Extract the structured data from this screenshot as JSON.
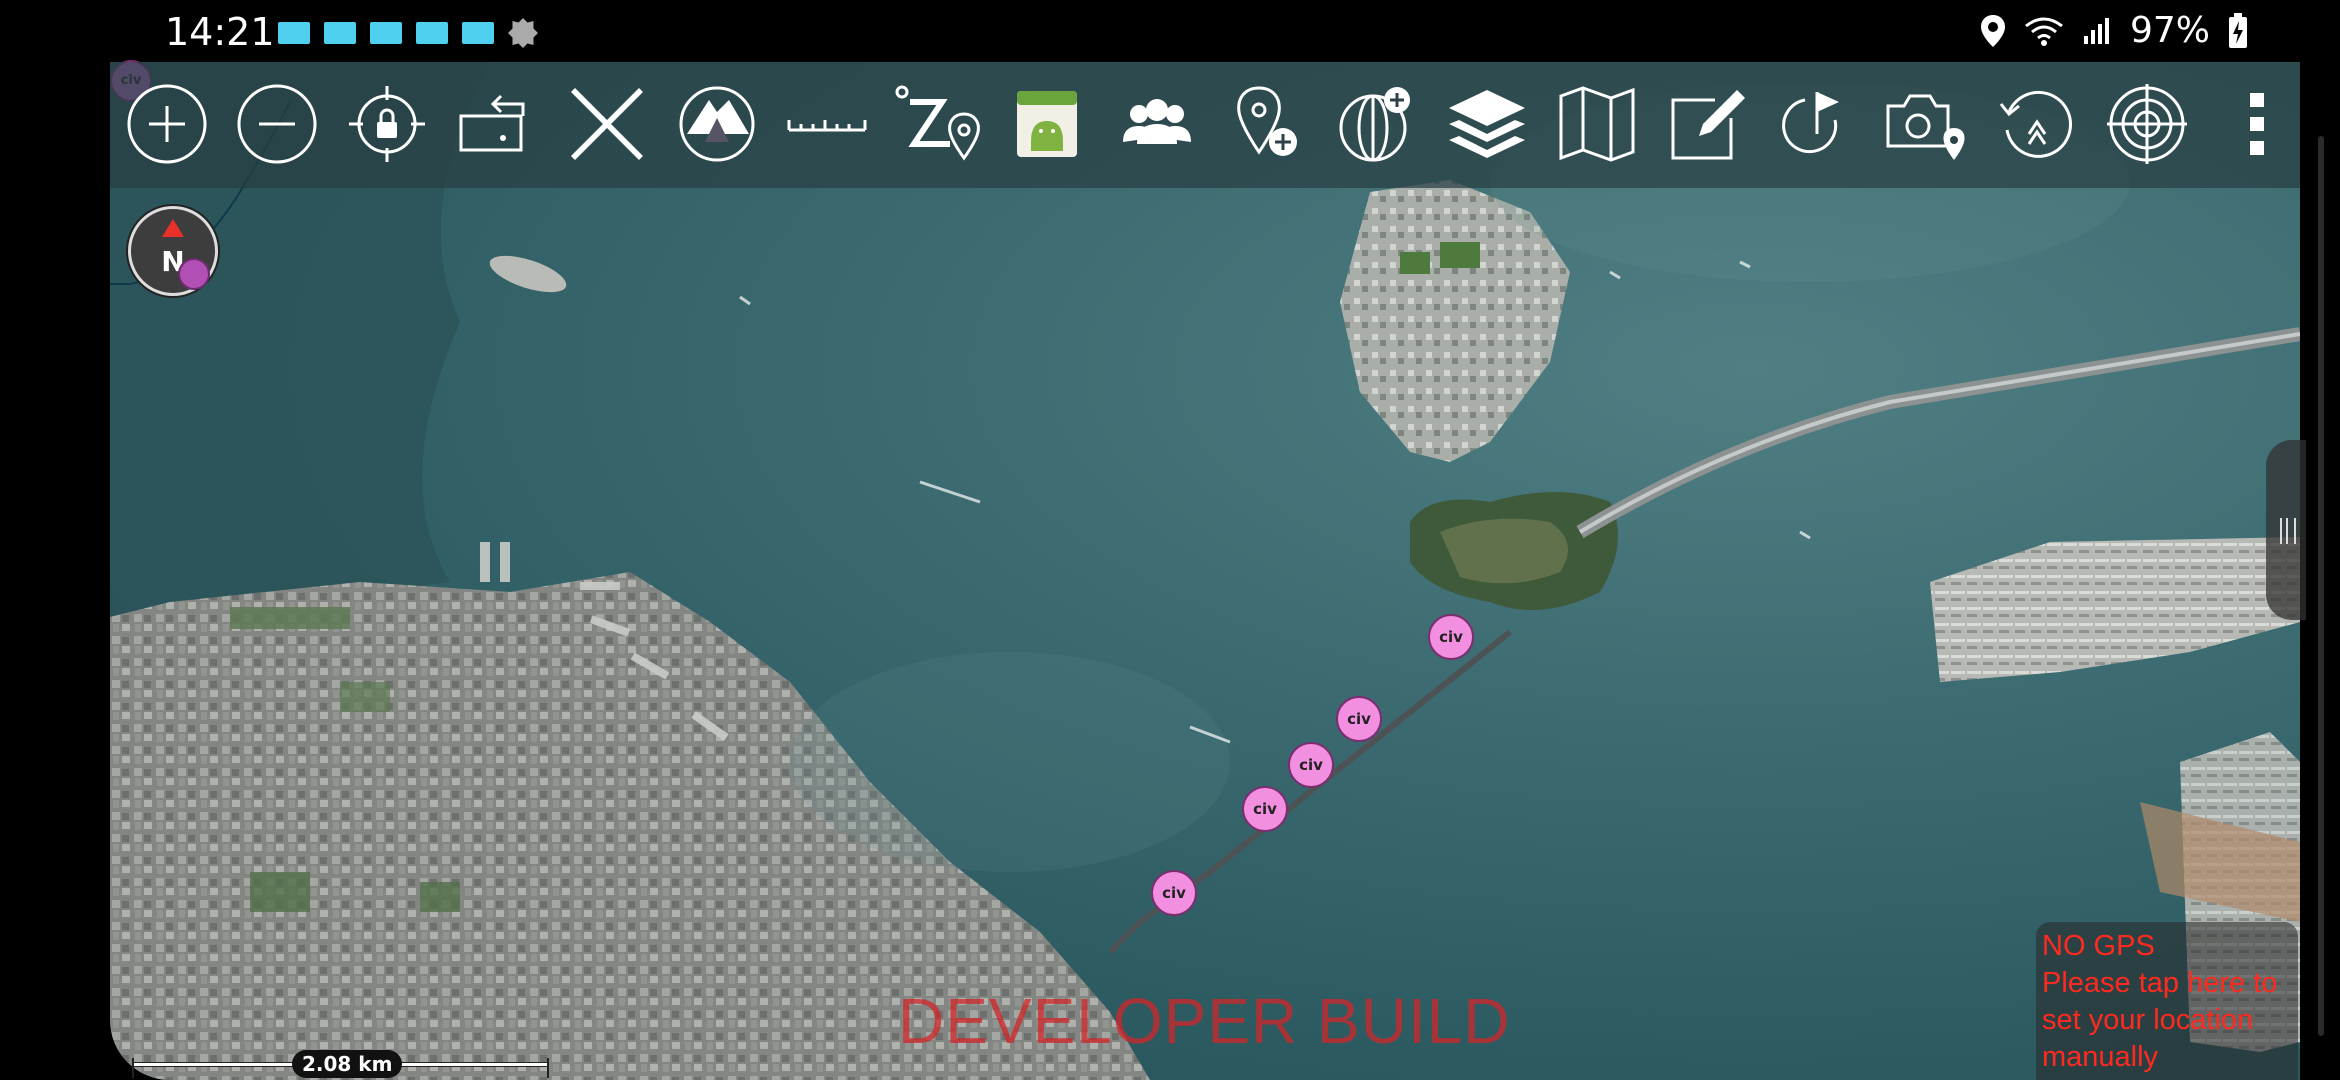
{
  "status_bar": {
    "time": "14:21",
    "notification_icons": [
      "notification-icon",
      "notification-icon",
      "notification-icon",
      "notification-icon",
      "notification-icon",
      "settings-cog-icon"
    ],
    "battery_text": "97%",
    "icons": [
      "location-icon",
      "wifi-icon",
      "signal-icon",
      "battery-charging-icon"
    ]
  },
  "toolbar": {
    "buttons": [
      {
        "name": "zoom-in-icon"
      },
      {
        "name": "zoom-out-icon"
      },
      {
        "name": "lock-location-icon"
      },
      {
        "name": "rotate-map-icon"
      },
      {
        "name": "close-x-icon"
      },
      {
        "name": "tilt-3d-icon"
      },
      {
        "name": "ruler-icon"
      },
      {
        "name": "route-waypoint-icon"
      },
      {
        "name": "android-app-icon"
      },
      {
        "name": "contacts-group-icon"
      },
      {
        "name": "add-point-icon"
      },
      {
        "name": "globe-add-icon"
      },
      {
        "name": "layers-icon"
      },
      {
        "name": "map-icon"
      },
      {
        "name": "edit-note-icon"
      },
      {
        "name": "flag-route-icon"
      },
      {
        "name": "camera-location-icon"
      },
      {
        "name": "history-navigate-icon"
      },
      {
        "name": "target-crosshair-icon"
      },
      {
        "name": "more-menu-icon"
      }
    ]
  },
  "compass": {
    "label": "N"
  },
  "markers": {
    "label": "civ"
  },
  "scale": {
    "label": "2.08 km"
  },
  "watermark": "DEVELOPER BUILD",
  "no_gps": {
    "title": "NO GPS",
    "message": "Please tap here to set your location manually"
  },
  "colors": {
    "marker_fill": "#f28fe0",
    "warning_red": "#ff2a1f",
    "water": "#3c6b71",
    "notification_blue": "#4fd0ee"
  }
}
